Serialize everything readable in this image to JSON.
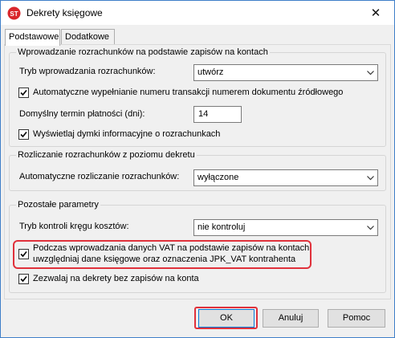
{
  "window": {
    "title": "Dekrety księgowe",
    "close_glyph": "✕"
  },
  "tabs": [
    {
      "label": "Podstawowe",
      "active": true
    },
    {
      "label": "Dodatkowe",
      "active": false
    }
  ],
  "group1": {
    "title": "Wprowadzanie rozrachunków na podstawie zapisów na kontach",
    "mode_label": "Tryb wprowadzania rozrachunków:",
    "mode_value": "utwórz",
    "autofill_label": "Automatyczne wypełnianie numeru transakcji numerem dokumentu źródłowego",
    "autofill_checked": true,
    "due_label": "Domyślny termin płatności (dni):",
    "due_value": "14",
    "tooltips_label": "Wyświetlaj dymki informacyjne o rozrachunkach",
    "tooltips_checked": true
  },
  "group2": {
    "title": "Rozliczanie rozrachunków z poziomu dekretu",
    "auto_label": "Automatyczne rozliczanie rozrachunków:",
    "auto_value": "wyłączone"
  },
  "group3": {
    "title": "Pozostałe parametry",
    "costs_label": "Tryb kontroli kręgu kosztów:",
    "costs_value": "nie kontroluj",
    "vat_label_line1": "Podczas wprowadzania danych VAT na podstawie zapisów na kontach",
    "vat_label_line2": "uwzględniaj dane księgowe oraz oznaczenia JPK_VAT kontrahenta",
    "vat_checked": true,
    "allow_label": "Zezwalaj na dekrety bez zapisów na konta",
    "allow_checked": true
  },
  "buttons": {
    "ok": "OK",
    "cancel": "Anuluj",
    "help": "Pomoc"
  },
  "colors": {
    "highlight": "#e0313b",
    "accent": "#0078d7"
  }
}
